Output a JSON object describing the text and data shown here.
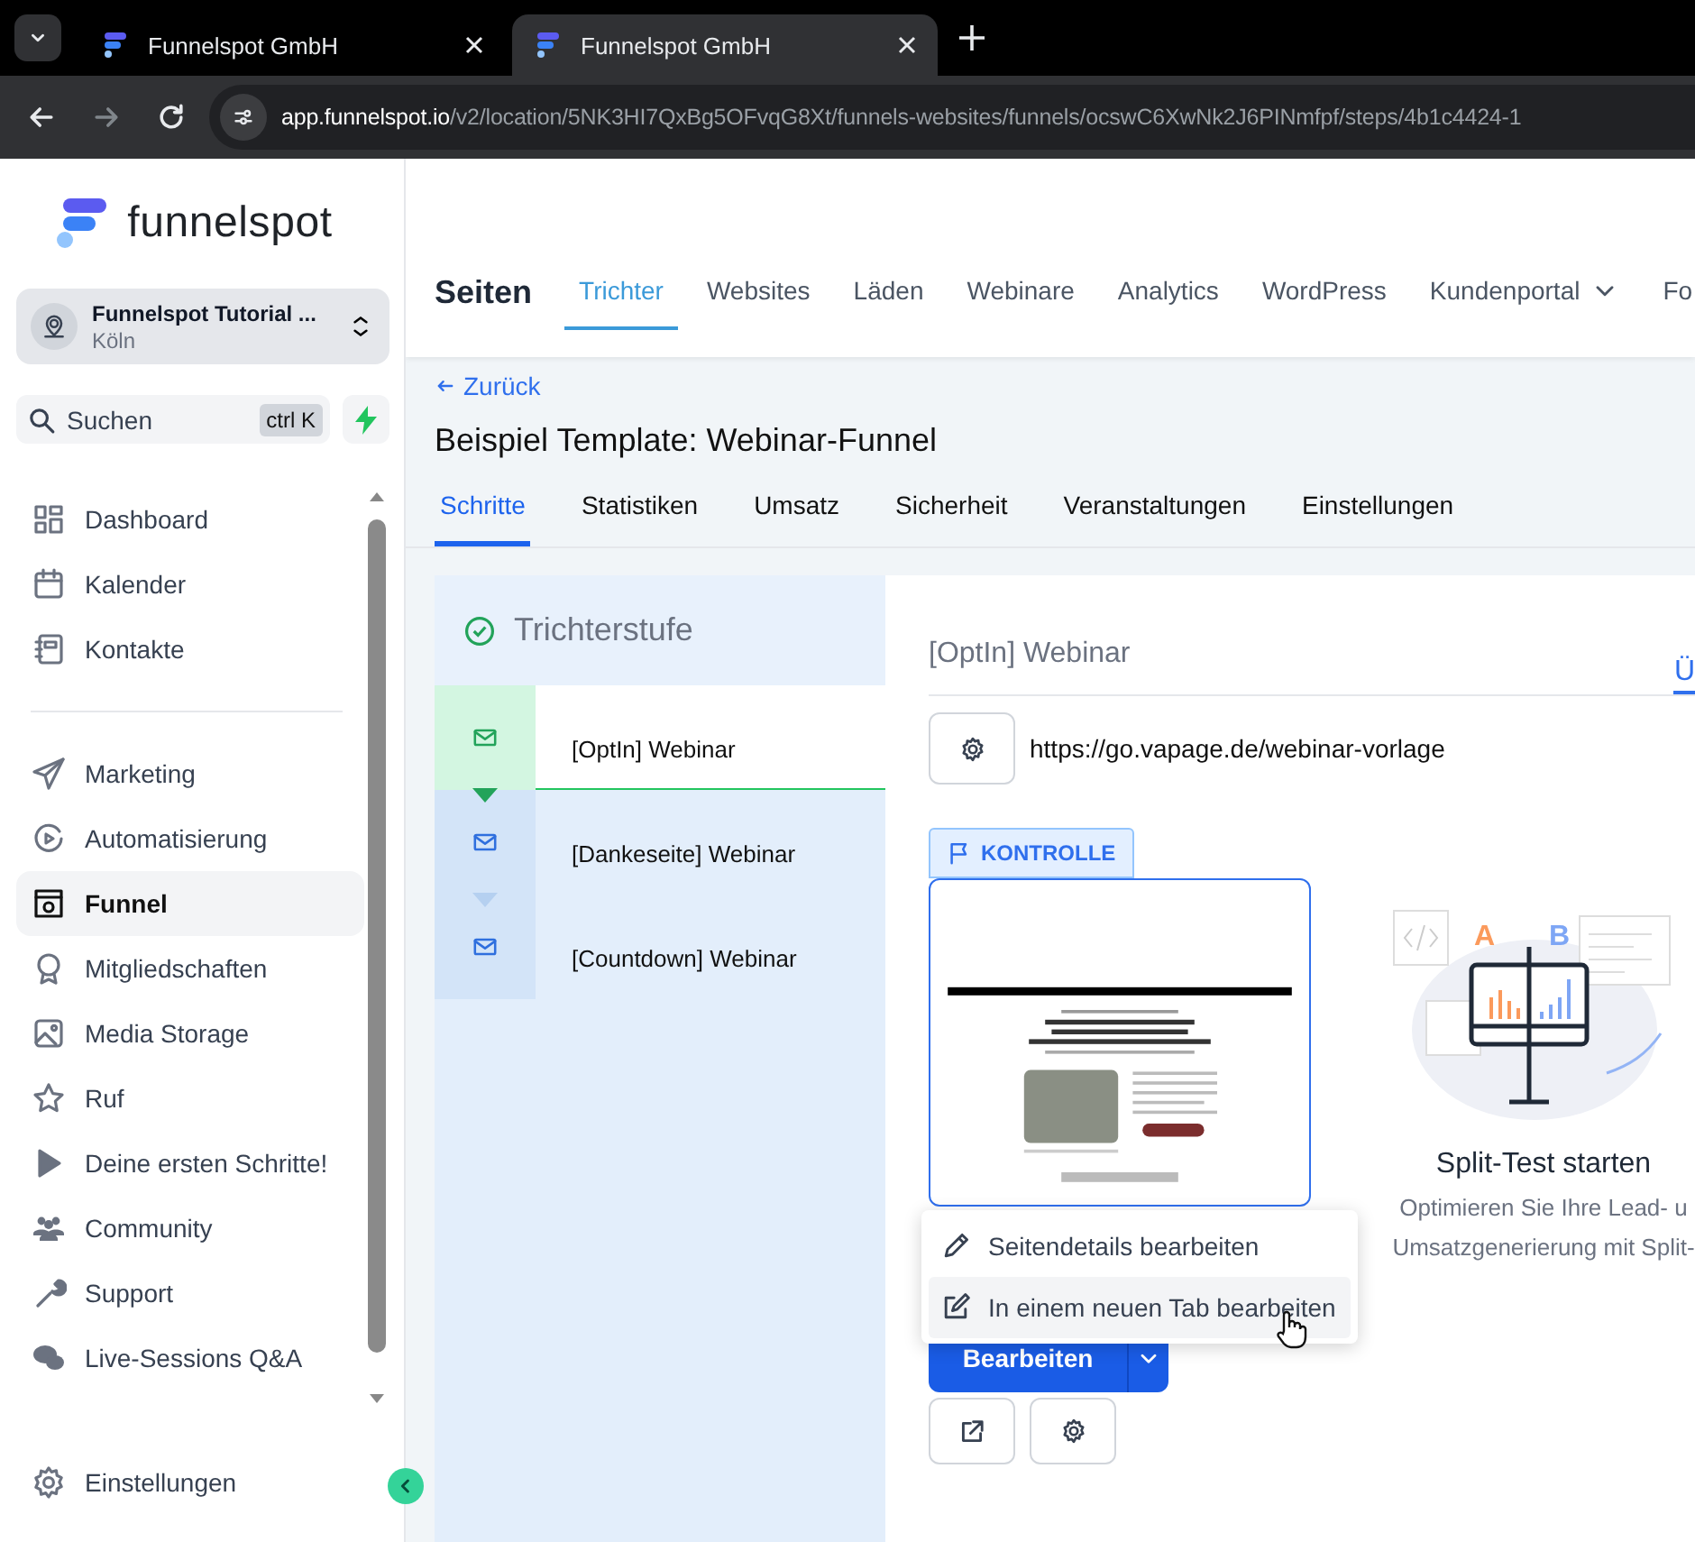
{
  "browser": {
    "tabs": [
      {
        "title": "Funnelspot GmbH",
        "selected": false
      },
      {
        "title": "Funnelspot GmbH",
        "selected": true
      }
    ],
    "url_host": "app.funnelspot.io",
    "url_path": "/v2/location/5NK3HI7QxBg5OFvqG8Xt/funnels-websites/funnels/ocswC6XwNk2J6PINmfpf/steps/4b1c4424-1"
  },
  "sidebar": {
    "logo": "funnelspot",
    "location": {
      "name": "Funnelspot Tutorial ...",
      "city": "Köln"
    },
    "search": {
      "placeholder": "Suchen",
      "shortcut": "ctrl K"
    },
    "groups": [
      [
        {
          "label": "Dashboard",
          "selected": false
        },
        {
          "label": "Kalender",
          "selected": false
        },
        {
          "label": "Kontakte",
          "selected": false
        }
      ],
      [
        {
          "label": "Marketing",
          "selected": false
        },
        {
          "label": "Automatisierung",
          "selected": false
        },
        {
          "label": "Funnel",
          "selected": true
        },
        {
          "label": "Mitgliedschaften",
          "selected": false
        },
        {
          "label": "Media Storage",
          "selected": false
        },
        {
          "label": "Ruf",
          "selected": false
        },
        {
          "label": "Deine ersten Schritte!",
          "selected": false
        },
        {
          "label": "Community",
          "selected": false
        },
        {
          "label": "Support",
          "selected": false
        },
        {
          "label": "Live-Sessions Q&A",
          "selected": false
        }
      ]
    ],
    "footer_item": "Einstellungen"
  },
  "top_nav": {
    "title": "Seiten",
    "tabs": [
      {
        "label": "Trichter",
        "selected": true,
        "kind": "plain"
      },
      {
        "label": "Websites",
        "selected": false,
        "kind": "plain"
      },
      {
        "label": "Läden",
        "selected": false,
        "kind": "plain"
      },
      {
        "label": "Webinare",
        "selected": false,
        "kind": "plain"
      },
      {
        "label": "Analytics",
        "selected": false,
        "kind": "plain"
      },
      {
        "label": "WordPress",
        "selected": false,
        "kind": "plain"
      },
      {
        "label": "Kundenportal",
        "selected": false,
        "kind": "dropdown"
      },
      {
        "label": "Fo",
        "selected": false,
        "kind": "plain"
      }
    ]
  },
  "funnel": {
    "back": "Zurück",
    "title": "Beispiel Template: Webinar-Funnel",
    "tabs": [
      {
        "label": "Schritte",
        "selected": true
      },
      {
        "label": "Statistiken",
        "selected": false
      },
      {
        "label": "Umsatz",
        "selected": false
      },
      {
        "label": "Sicherheit",
        "selected": false
      },
      {
        "label": "Veranstaltungen",
        "selected": false
      },
      {
        "label": "Einstellungen",
        "selected": false
      }
    ]
  },
  "steps": {
    "header": "Trichterstufe",
    "items": [
      {
        "name": "[OptIn] Webinar",
        "selected": true
      },
      {
        "name": "[Dankeseite] Webinar",
        "selected": false
      },
      {
        "name": "[Countdown] Webinar",
        "selected": false
      }
    ]
  },
  "step_detail": {
    "title": "[OptIn] Webinar",
    "tab": "Ü",
    "url": "https://go.vapage.de/webinar-vorlage",
    "badge": "KONTROLLE",
    "menu": [
      {
        "label": "Seitendetails bearbeiten",
        "hovered": false
      },
      {
        "label": "In einem neuen Tab bearbeiten",
        "hovered": true
      }
    ],
    "edit_button": "Bearbeiten",
    "split_test": {
      "labels": [
        "A",
        "B"
      ],
      "title": "Split-Test starten",
      "description": [
        "Optimieren Sie Ihre Lead- u",
        "Umsatzgenerierung mit Split-"
      ]
    }
  }
}
